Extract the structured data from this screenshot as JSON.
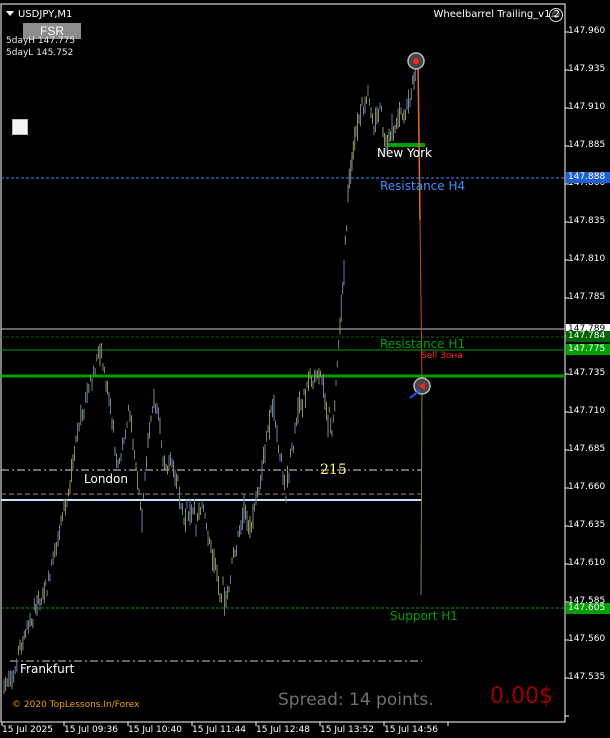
{
  "symbol": "USDJPY,M1",
  "ea_name": "Wheelbarrel Trailing_v1.2",
  "fsr_button": "FSR",
  "five_day_high": "5dayH 147.775",
  "five_day_low": "5dayL 145.752",
  "sessions": [
    "New York",
    "London",
    "Frankfurt"
  ],
  "levels": {
    "resistance_h4": "Resistance H4",
    "resistance_h1": "Resistance H1",
    "sell_zone": "Sell Зона",
    "support_h1": "Support H1"
  },
  "range_points": "215",
  "copyright": "© 2020 TopLessons.In/Forex",
  "spread": "Spread: 14 points.",
  "profit": "0.00$",
  "price_ticks": [
    "147.960",
    "147.935",
    "147.910",
    "147.885",
    "147.860",
    "147.835",
    "147.810",
    "147.785",
    "147.760",
    "147.735",
    "147.710",
    "147.685",
    "147.660",
    "147.635",
    "147.610",
    "147.585",
    "147.560",
    "147.535"
  ],
  "price_tags": [
    {
      "text": "147.888",
      "bg": "#1e5fd4",
      "fg": "#ffffff"
    },
    {
      "text": "147.789",
      "bg": "#ffffff",
      "fg": "#000000"
    },
    {
      "text": "147.784",
      "bg": "#006400",
      "fg": "#ffffff"
    },
    {
      "text": "147.775",
      "bg": "#00a000",
      "fg": "#ffffff"
    },
    {
      "text": "147.605",
      "bg": "#00a000",
      "fg": "#ffffff"
    }
  ],
  "time_labels": [
    "15 Jul 2025",
    "15 Jul 09:36",
    "15 Jul 10:40",
    "15 Jul 11:44",
    "15 Jul 12:48",
    "15 Jul 13:52",
    "15 Jul 14:56"
  ],
  "colors": {
    "background": "#000000",
    "candles": "#8a8a55",
    "resistance_h4": "#3f8fff",
    "resistance_h1": "#00a000",
    "support_h1": "#00a000",
    "sell_zone": "#ff2020",
    "trade_line": "#e07020",
    "range_line": "#ffffff"
  }
}
